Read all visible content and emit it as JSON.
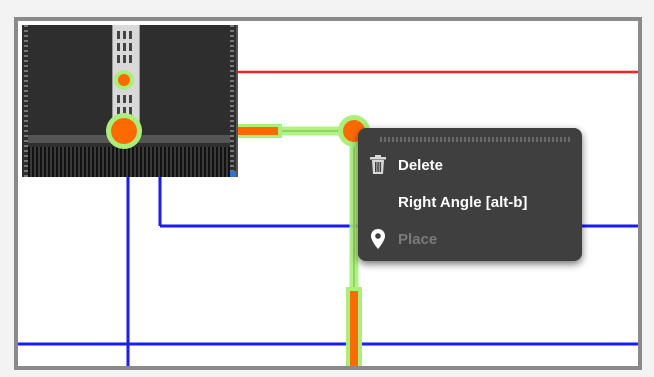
{
  "menu": {
    "items": [
      {
        "label": "Delete",
        "icon": "trash-icon",
        "enabled": true
      },
      {
        "label": "Right Angle [alt-b]",
        "icon": "",
        "enabled": true
      },
      {
        "label": "Place",
        "icon": "location-pin-icon",
        "enabled": false
      }
    ]
  },
  "colors": {
    "wire_blue": "#1a1aff",
    "wire_red": "#ee2222",
    "selected_wire": "#ff6a00",
    "selection_glow": "#a8f07a",
    "menu_bg": "#3f3f3f",
    "frame_border": "#8a8a8a"
  }
}
